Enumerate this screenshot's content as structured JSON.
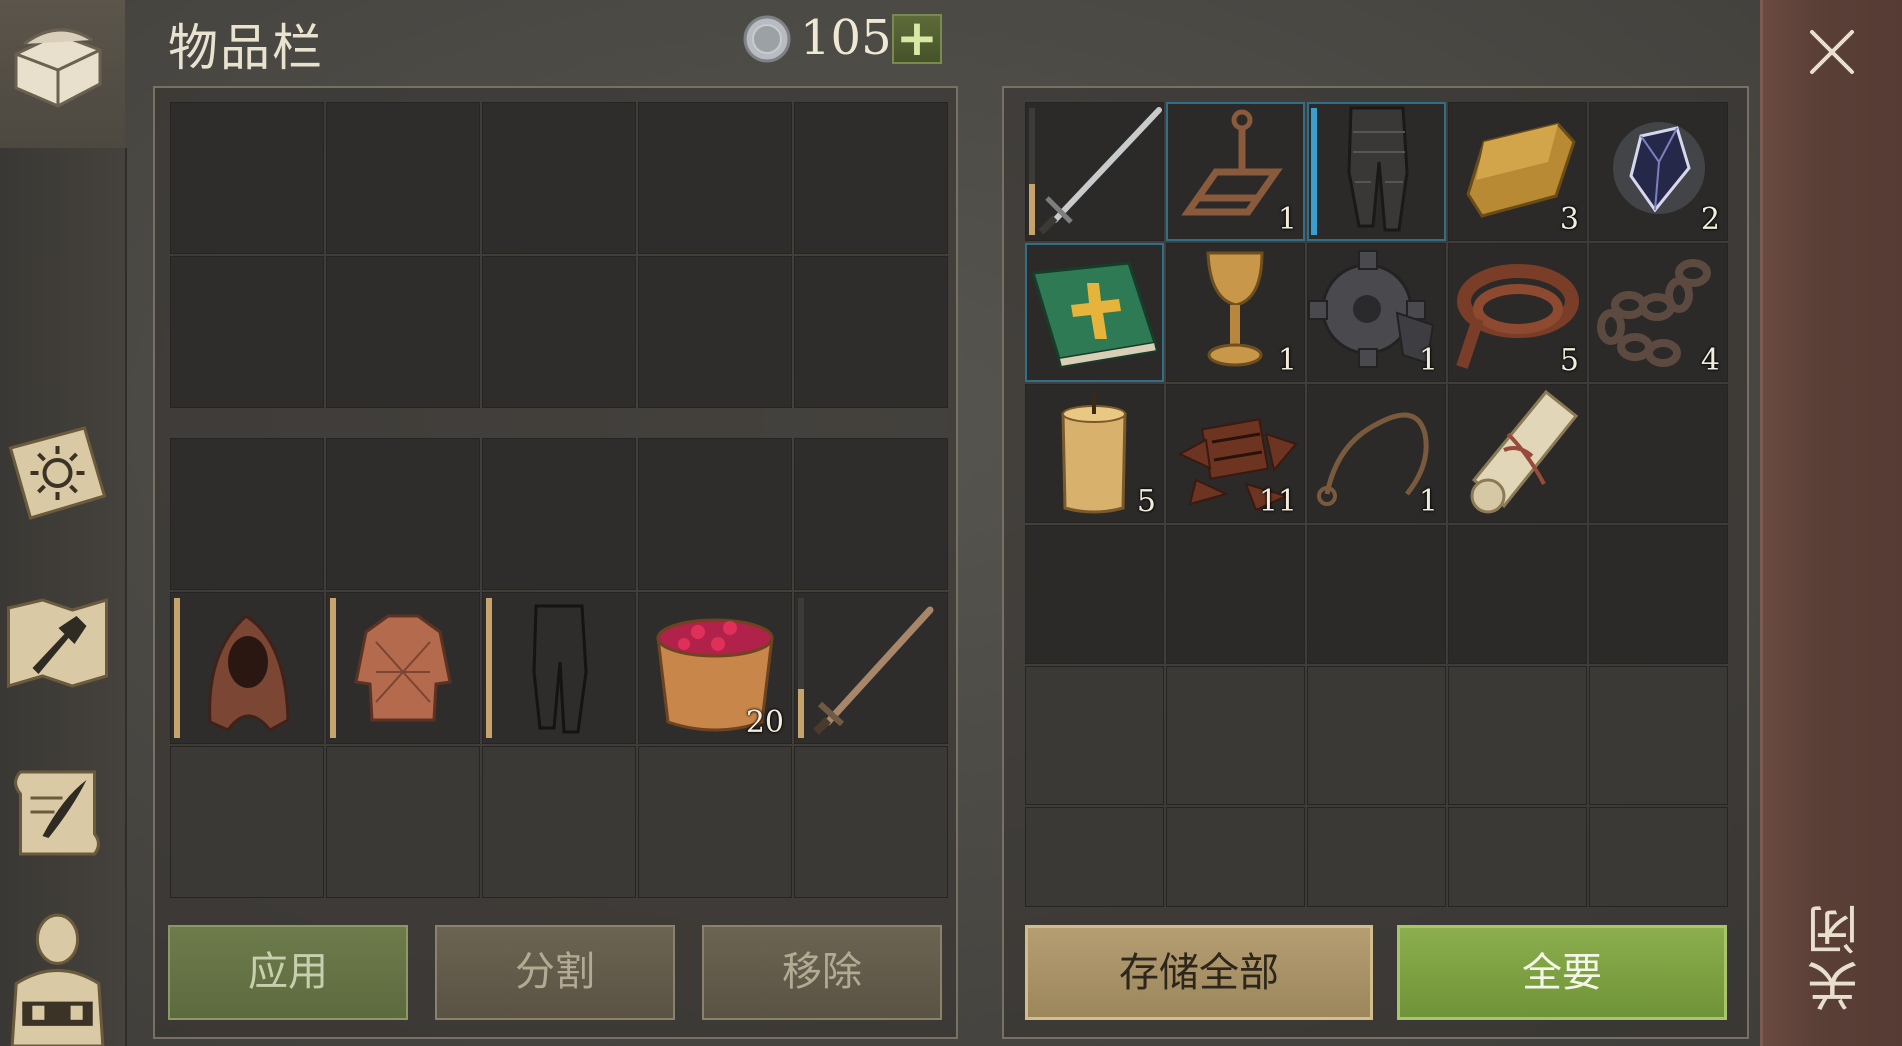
{
  "window": {
    "title": "物品栏",
    "close_label": "关闭"
  },
  "currency": {
    "icon": "silver-coin-icon",
    "amount": "105",
    "add_label": "+"
  },
  "buttons": {
    "apply": "应用",
    "split": "分割",
    "remove": "移除",
    "store_all": "存储全部",
    "take_all": "全要"
  },
  "sidebar": {
    "items": [
      "chest-icon",
      "sun-book-icon",
      "hammer-map-icon",
      "scroll-quill-icon",
      "character-icon"
    ]
  },
  "inventory_equipped": [
    {
      "name": "hood",
      "icon": "hood-icon",
      "durability": 1.0
    },
    {
      "name": "gambeson",
      "icon": "gambeson-icon",
      "durability": 1.0
    },
    {
      "name": "pants",
      "icon": "pants-icon",
      "durability": 1.0
    },
    {
      "name": "berry-bucket",
      "icon": "berry-bucket-icon",
      "qty": "20"
    },
    {
      "name": "sword",
      "icon": "sword-icon",
      "durability": 0.35
    }
  ],
  "storage_items": [
    {
      "name": "sword",
      "icon": "sword-icon",
      "durability": 0.4
    },
    {
      "name": "crank-frame",
      "icon": "crank-frame-icon",
      "qty": "1",
      "highlight": true
    },
    {
      "name": "armored-leggings",
      "icon": "leggings-icon",
      "durability": 1.0,
      "bar": "blue",
      "highlight": true
    },
    {
      "name": "gold-ingot",
      "icon": "ingot-icon",
      "qty": "3"
    },
    {
      "name": "blue-crystal",
      "icon": "crystal-icon",
      "qty": "2"
    },
    {
      "name": "holy-book",
      "icon": "book-icon",
      "highlight": true
    },
    {
      "name": "chalice",
      "icon": "chalice-icon",
      "qty": "1"
    },
    {
      "name": "gear",
      "icon": "gear-icon",
      "qty": "1"
    },
    {
      "name": "leather-strip",
      "icon": "leather-icon",
      "qty": "5"
    },
    {
      "name": "chain",
      "icon": "chain-icon",
      "qty": "4"
    },
    {
      "name": "candle",
      "icon": "candle-icon",
      "qty": "5"
    },
    {
      "name": "rusty-scraps",
      "icon": "scraps-icon",
      "qty": "11"
    },
    {
      "name": "rope",
      "icon": "rope-icon",
      "qty": "1"
    },
    {
      "name": "scroll",
      "icon": "scroll-icon"
    }
  ],
  "colors": {
    "accent_green": "#8cae4d",
    "durability": "#c7a46b",
    "highlight": "#2f6f8a",
    "close_strip": "#5a3f37"
  }
}
